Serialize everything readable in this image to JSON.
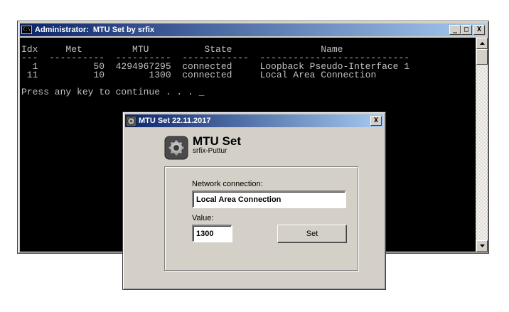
{
  "console": {
    "title": "Administrator:  MTU Set by srfix",
    "icon": "cmd-icon",
    "window_buttons": {
      "minimize": "_",
      "maximize": "□",
      "close": "X"
    },
    "header": "Idx     Met         MTU          State                Name",
    "separator": "---  ----------  ----------  ------------  ---------------------------",
    "rows": [
      "  1          50  4294967295  connected     Loopback Pseudo-Interface 1",
      " 11          10        1300  connected     Local Area Connection"
    ],
    "prompt": "Press any key to continue . . . ",
    "cursor": "_"
  },
  "dialog": {
    "title": "MTU Set 22.11.2017",
    "close": "X",
    "app_name": "MTU Set",
    "author": "srfix-Puttur",
    "network_label": "Network connection:",
    "network_value": "Local Area Connection",
    "value_label": "Value:",
    "value_value": "1300",
    "set_label": "Set"
  },
  "colors": {
    "title_gradient_start": "#0a246a",
    "title_gradient_end": "#a6caf0",
    "console_bg": "#000000",
    "console_text": "#c0c0c0",
    "window_face": "#d4d0c8"
  }
}
